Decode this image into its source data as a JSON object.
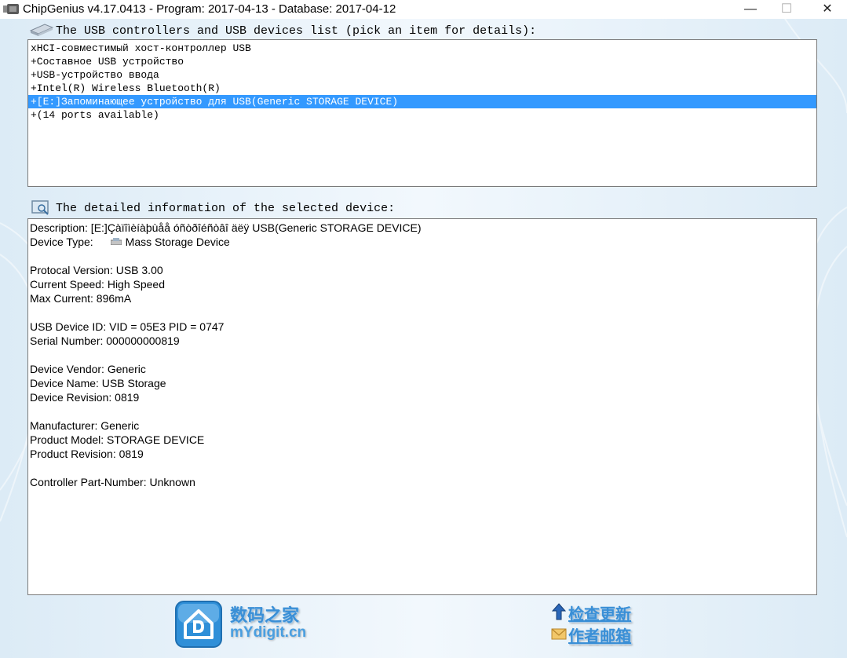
{
  "window": {
    "title": "ChipGenius v4.17.0413 - Program: 2017-04-13 - Database: 2017-04-12",
    "icon": "usb-drive-icon",
    "minimize_glyph": "—",
    "maximize_glyph": "☐",
    "close_glyph": "✕"
  },
  "devices_section": {
    "label": "The USB controllers and USB devices list (pick an item for details):",
    "icon": "usb-drive-icon",
    "items": [
      {
        "label": "xHCI-совместимый хост-контроллер USB",
        "selected": false
      },
      {
        "label": "+Составное USB устройство",
        "selected": false
      },
      {
        "label": "+USB-устройство ввода",
        "selected": false
      },
      {
        "label": "+Intel(R) Wireless Bluetooth(R)",
        "selected": false
      },
      {
        "label": "+[E:]Запоминающее устройство для USB(Generic STORAGE DEVICE)",
        "selected": true
      },
      {
        "label": "+(14 ports available)",
        "selected": false
      }
    ]
  },
  "details_section": {
    "label": "The detailed information of the selected device:",
    "icon": "monitor-search-icon",
    "description": "Description: [E:]Çàïîìèíàþùåå óñòðîéñòâî äëÿ USB(Generic STORAGE DEVICE)",
    "device_type_label": "Device Type:",
    "device_type_value": "Mass Storage Device",
    "protocol_version": "Protocal Version: USB 3.00",
    "current_speed": "Current Speed: High Speed",
    "max_current": "Max Current: 896mA",
    "usb_device_id": "USB Device ID: VID = 05E3 PID = 0747",
    "serial_number": "Serial Number: 000000000819",
    "device_vendor": "Device Vendor: Generic",
    "device_name": "Device Name: USB Storage",
    "device_revision": "Device Revision: 0819",
    "manufacturer": "Manufacturer: Generic",
    "product_model": "Product Model: STORAGE DEVICE",
    "product_revision": "Product Revision: 0819",
    "controller_part_number": "Controller Part-Number: Unknown"
  },
  "footer": {
    "logo_text": "数码之家",
    "logo_subtext": "mYdigit.cn",
    "check_update": "检查更新",
    "author_email": "作者邮箱"
  },
  "colors": {
    "selection": "#3399ff",
    "accent": "#3a8fd6"
  }
}
